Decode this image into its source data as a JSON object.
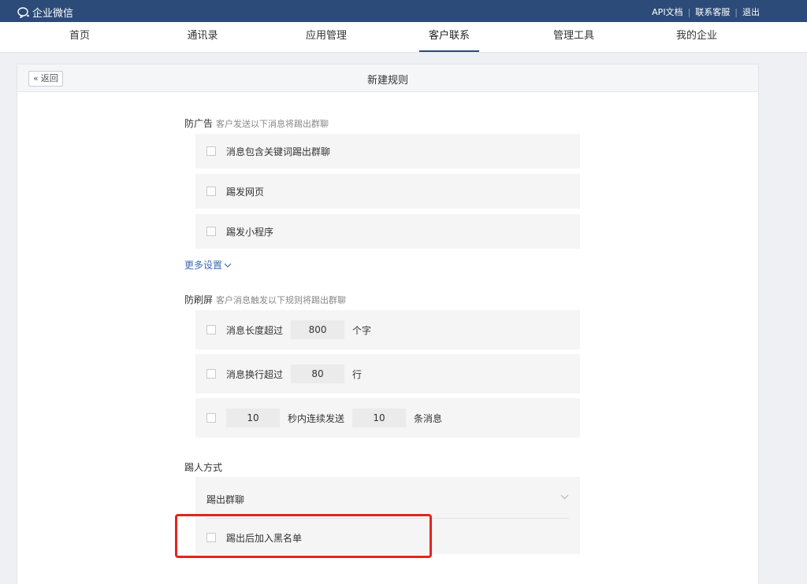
{
  "topbar": {
    "brand": "企业微信",
    "links": [
      "API文档",
      "联系客服",
      "退出"
    ]
  },
  "nav": {
    "items": [
      "首页",
      "通讯录",
      "应用管理",
      "客户联系",
      "管理工具",
      "我的企业"
    ],
    "active": "客户联系"
  },
  "page": {
    "back_label": "返回",
    "title": "新建规则"
  },
  "anti_ad": {
    "title": "防广告",
    "hint": "客户发送以下消息将踢出群聊",
    "options": [
      "消息包含关键词踢出群聊",
      "踢发网页",
      "踢发小程序"
    ],
    "more": "更多设置"
  },
  "anti_spam": {
    "title": "防刷屏",
    "hint": "客户消息触发以下规则将踢出群聊",
    "length": {
      "prefix": "消息长度超过",
      "value": "800",
      "suffix": "个字"
    },
    "lines": {
      "prefix": "消息换行超过",
      "value": "80",
      "suffix": "行"
    },
    "rate": {
      "seconds": "10",
      "middle": "秒内连续发送",
      "count": "10",
      "suffix": "条消息"
    }
  },
  "kick": {
    "title": "踢人方式",
    "selected": "踢出群聊",
    "option_blacklist": "踢出后加入黑名单"
  },
  "colors": {
    "topbar": "#2c4b78",
    "highlight": "#e1261c",
    "link": "#3b6bb0"
  }
}
